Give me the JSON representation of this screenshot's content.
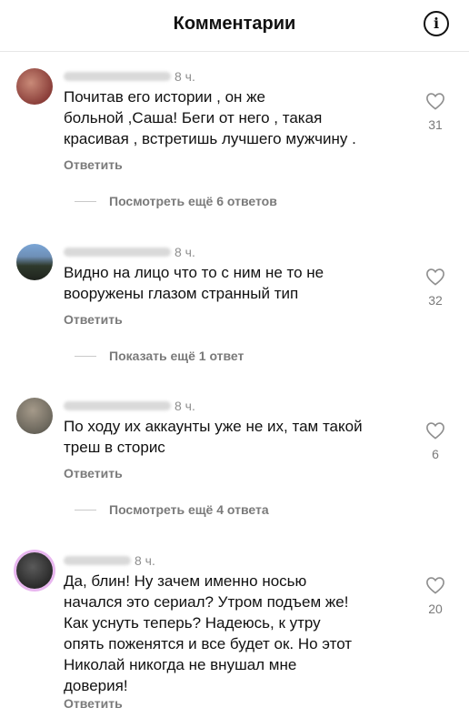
{
  "header": {
    "title": "Комментарии",
    "info_icon": "info-icon"
  },
  "actions": {
    "reply": "Ответить"
  },
  "comments": [
    {
      "time": "8 ч.",
      "text": "Почитав его истории , он же\nбольной ,Саша! Беги от него , такая\nкрасивая , встретишь лучшего мужчину .",
      "likes": "31",
      "more": "Посмотреть ещё 6 ответов"
    },
    {
      "time": "8 ч.",
      "text": "Видно на лицо что то с ним не то не\nвооружены глазом странный тип",
      "likes": "32",
      "more": "Показать ещё 1 ответ"
    },
    {
      "time": "8 ч.",
      "text": "По ходу их аккаунты уже не их, там такой\nтреш в сторис",
      "likes": "6",
      "more": "Посмотреть ещё 4 ответа"
    },
    {
      "time": "8 ч.",
      "text": "Да, блин! Ну зачем именно носью\nначался это сериал? Утром подъем же!\nКак уснуть теперь? Надеюсь, к утру\nопять поженятся и все будет ок. Но этот\nНиколай никогда не внушал мне\nдоверия!",
      "likes": "20",
      "more": ""
    }
  ]
}
